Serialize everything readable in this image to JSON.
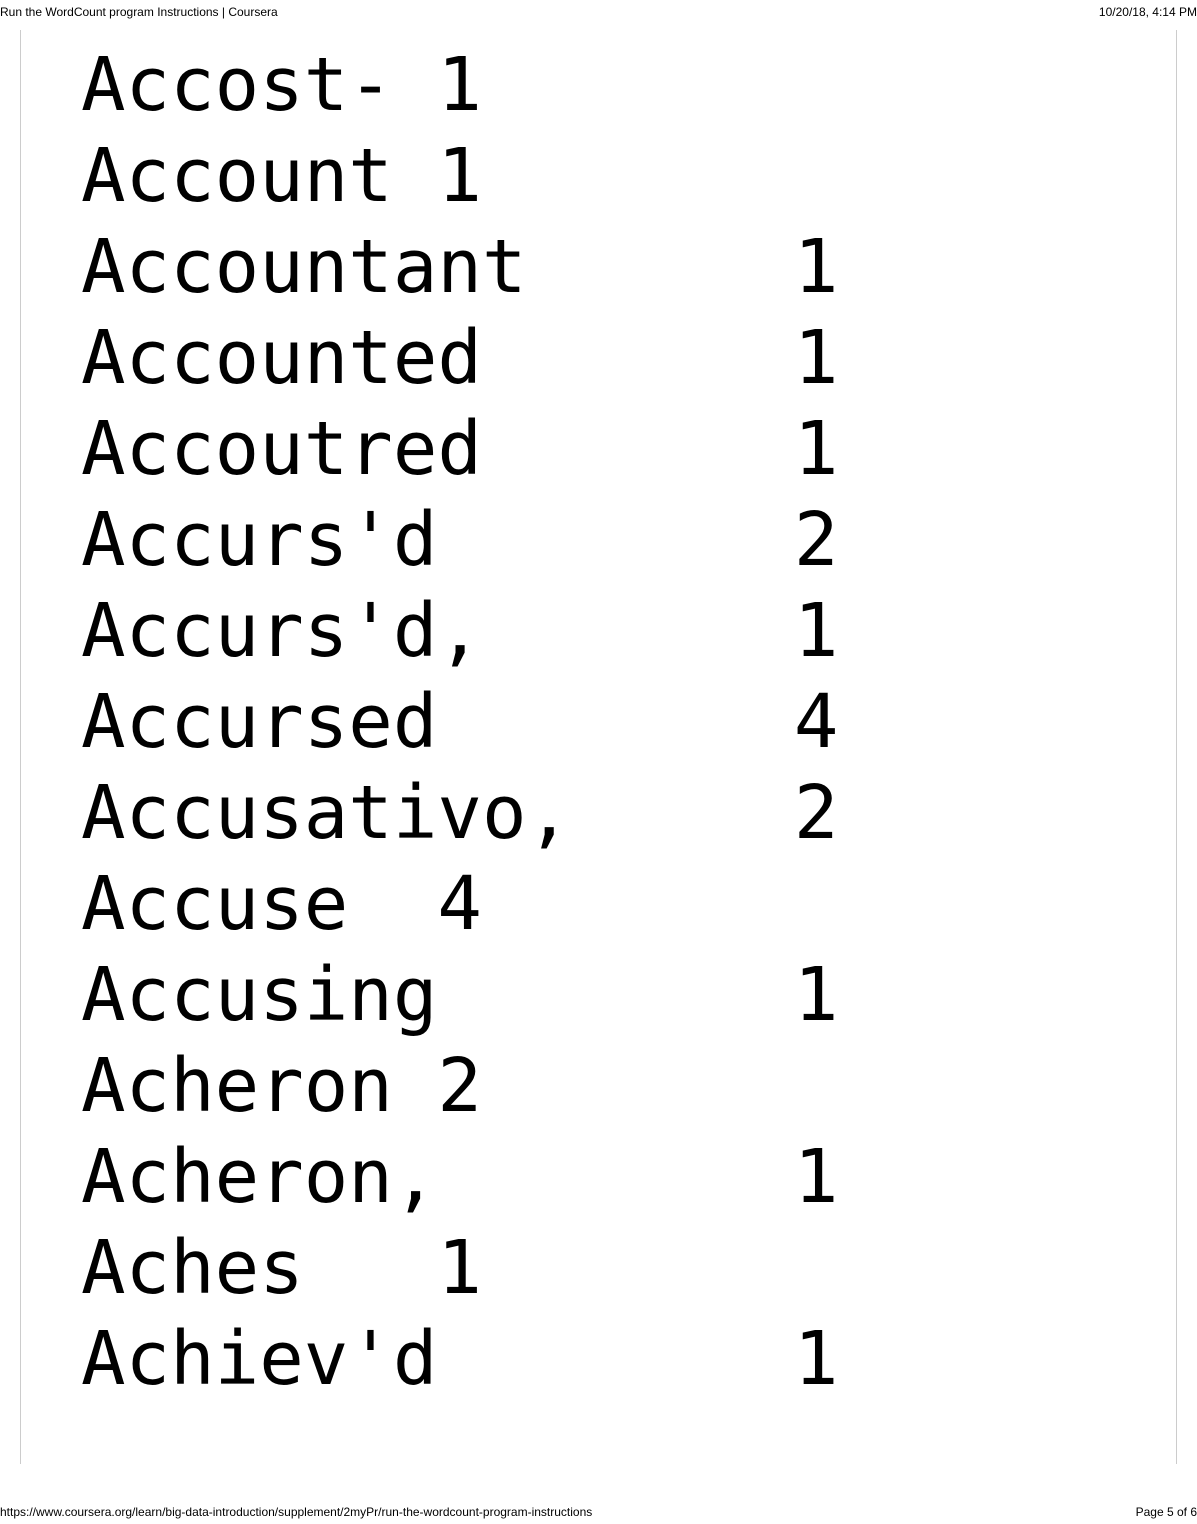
{
  "header": {
    "title": "Run the WordCount program Instructions | Coursera",
    "timestamp": "10/20/18, 4:14 PM"
  },
  "content": {
    "lines": [
      "Accost- 1",
      "Account 1",
      "Accountant      1",
      "Accounted       1",
      "Accoutred       1",
      "Accurs'd        2",
      "Accurs'd,       1",
      "Accursed        4",
      "Accusativo,     2",
      "Accuse  4",
      "Accusing        1",
      "Acheron 2",
      "Acheron,        1",
      "Aches   1",
      "Achiev'd        1"
    ]
  },
  "footer": {
    "url": "https://www.coursera.org/learn/big-data-introduction/supplement/2myPr/run-the-wordcount-program-instructions",
    "pagination": "Page 5 of 6"
  }
}
